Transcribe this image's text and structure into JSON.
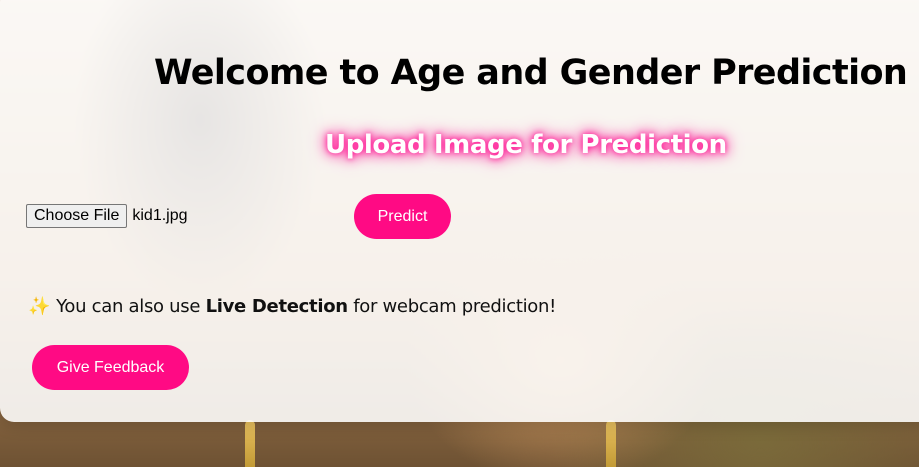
{
  "page": {
    "title": "Welcome to Age and Gender Prediction",
    "subtitle": "Upload Image for Prediction"
  },
  "upload": {
    "choose_file_label": "Choose File",
    "selected_file": "kid1.jpg",
    "predict_label": "Predict"
  },
  "live_detection": {
    "icon": "sparkles-icon",
    "prefix": "You can also use",
    "highlight": "Live Detection",
    "suffix": "for webcam prediction!"
  },
  "feedback": {
    "button_label": "Give Feedback"
  },
  "colors": {
    "accent": "#ff0a84",
    "subtitle_glow": "#ff1493"
  }
}
